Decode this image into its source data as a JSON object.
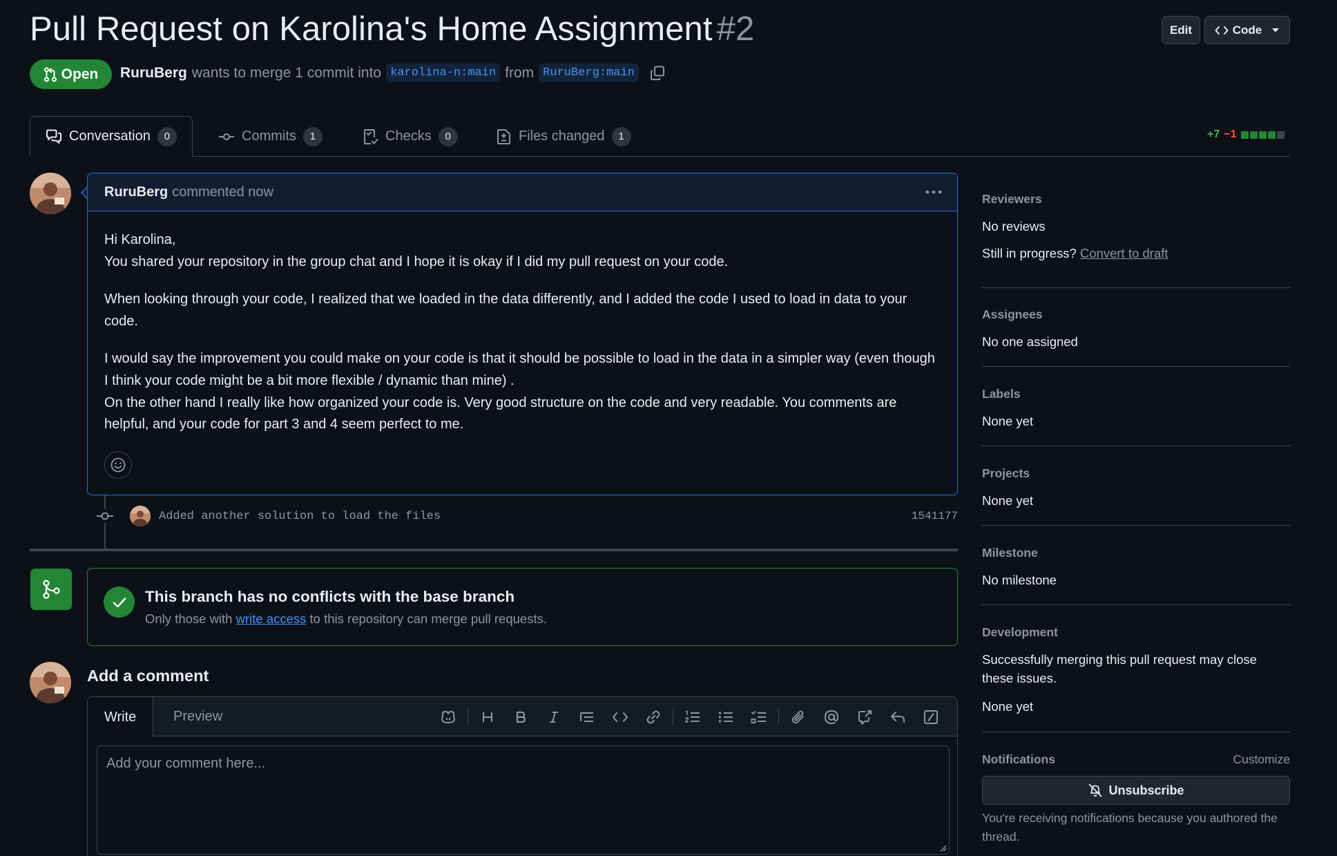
{
  "header": {
    "title": "Pull Request on Karolina's Home Assignment",
    "number": "#2",
    "edit_label": "Edit",
    "code_label": "Code"
  },
  "status": {
    "state": "Open",
    "author": "RuruBerg",
    "merge_text": "wants to merge 1 commit into",
    "base_branch": "karolina-n:main",
    "from_text": "from",
    "head_branch": "RuruBerg:main"
  },
  "tabs": [
    {
      "label": "Conversation",
      "count": "0"
    },
    {
      "label": "Commits",
      "count": "1"
    },
    {
      "label": "Checks",
      "count": "0"
    },
    {
      "label": "Files changed",
      "count": "1"
    }
  ],
  "diffstat": {
    "additions": "+7",
    "deletions": "−1"
  },
  "comment": {
    "author": "RuruBerg",
    "action": "commented now",
    "body": {
      "p1_line1": "Hi Karolina,",
      "p1_line2": "You shared your repository in the group chat and I hope it is okay if I did my pull request on your code.",
      "p2": "When looking through your code, I realized that we loaded in the data differently, and I added the code I used to load in data to your code.",
      "p3": "I would say the improvement you could make on your code is that it should be possible to load in the data in a simpler way (even though I think your code might be a bit more flexible / dynamic than mine) .",
      "p4": "On the other hand I really like how organized your code is. Very good structure on the code and very readable. You comments are helpful, and your code for part 3 and 4 seem perfect to me."
    }
  },
  "commit": {
    "message": "Added another solution to load the files",
    "sha": "1541177"
  },
  "merge": {
    "title": "This branch has no conflicts with the base branch",
    "sub_before": "Only those with",
    "sub_link": "write access",
    "sub_after": "to this repository can merge pull requests."
  },
  "add_comment": {
    "title": "Add a comment",
    "write_tab": "Write",
    "preview_tab": "Preview",
    "placeholder": "Add your comment here..."
  },
  "sidebar": {
    "reviewers": {
      "heading": "Reviewers",
      "value": "No reviews",
      "draft_prompt": "Still in progress?",
      "draft_link": "Convert to draft"
    },
    "assignees": {
      "heading": "Assignees",
      "value": "No one assigned"
    },
    "labels": {
      "heading": "Labels",
      "value": "None yet"
    },
    "projects": {
      "heading": "Projects",
      "value": "None yet"
    },
    "milestone": {
      "heading": "Milestone",
      "value": "No milestone"
    },
    "development": {
      "heading": "Development",
      "description": "Successfully merging this pull request may close these issues.",
      "value": "None yet"
    },
    "notifications": {
      "heading": "Notifications",
      "customize": "Customize",
      "button": "Unsubscribe",
      "note": "You're receiving notifications because you authored the thread."
    }
  },
  "colors": {
    "background": "#0d1117",
    "accent_green": "#238636",
    "accent_blue": "#1f6feb",
    "link_blue": "#4493f8",
    "muted": "#8d96a0"
  },
  "icons": [
    "pull-request-icon",
    "code-icon",
    "chevron-down-icon",
    "copy-icon",
    "comment-discussion-icon",
    "commit-icon",
    "checklist-icon",
    "file-diff-icon",
    "kebab-icon",
    "smiley-icon",
    "git-merge-icon",
    "check-icon",
    "copilot-icon",
    "heading-icon",
    "bold-icon",
    "italic-icon",
    "quote-icon",
    "code-icon",
    "link-icon",
    "ordered-list-icon",
    "unordered-list-icon",
    "tasklist-icon",
    "paperclip-icon",
    "mention-icon",
    "cross-reference-icon",
    "reply-icon",
    "slash-icon",
    "bell-slash-icon"
  ]
}
